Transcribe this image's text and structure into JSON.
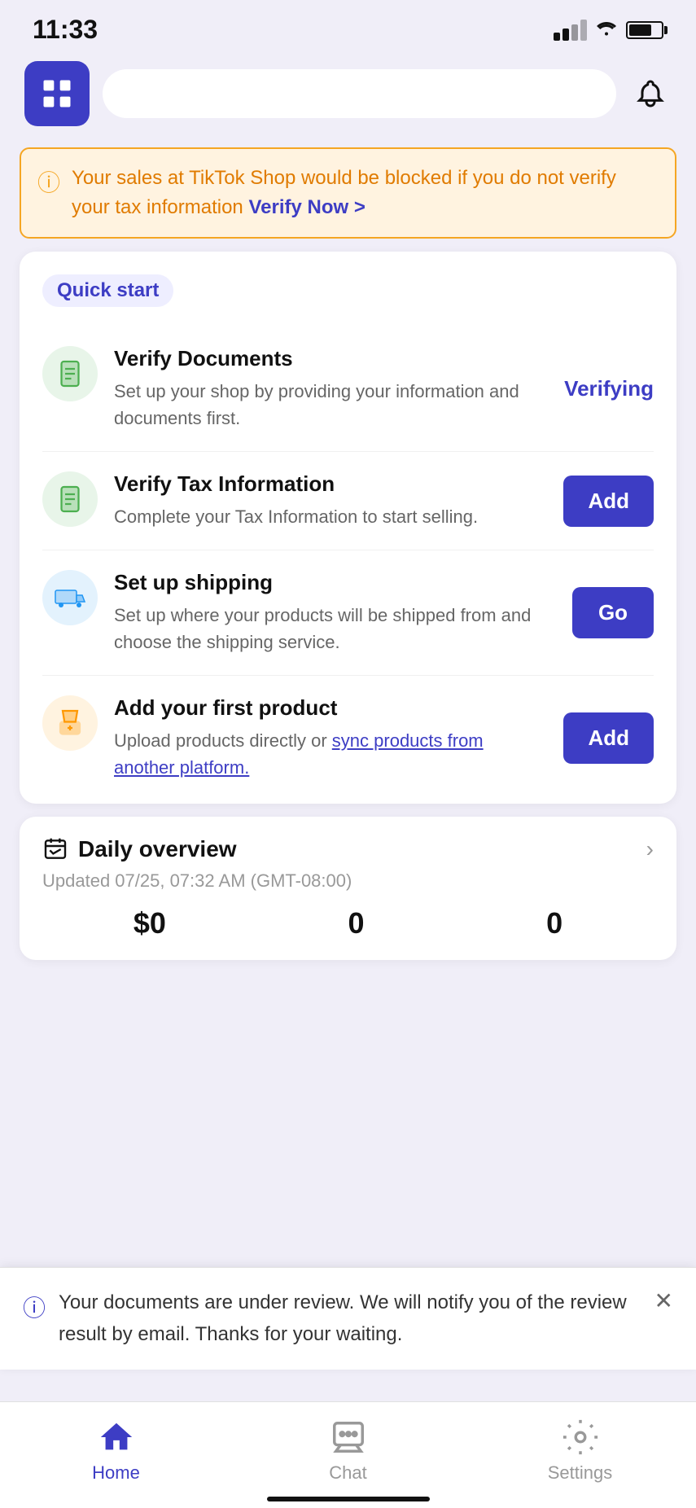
{
  "statusBar": {
    "time": "11:33"
  },
  "header": {
    "logo_alt": "TikTok Shop Logo",
    "bell_label": "Notifications"
  },
  "warning": {
    "text": "Your sales at TikTok Shop would be blocked if you do not verify your tax information ",
    "link_text": "Verify Now >",
    "icon": "⚠"
  },
  "quickStart": {
    "label": "Quick start",
    "items": [
      {
        "id": "verify-docs",
        "title": "Verify Documents",
        "description": "Set up your shop by providing your information and documents first.",
        "action_type": "text",
        "action_label": "Verifying",
        "icon": "📄",
        "icon_color": "green"
      },
      {
        "id": "verify-tax",
        "title": "Verify Tax Information",
        "description": "Complete your Tax Information to start selling.",
        "action_type": "button",
        "action_label": "Add",
        "icon": "📄",
        "icon_color": "green"
      },
      {
        "id": "setup-shipping",
        "title": "Set up shipping",
        "description": "Set up where your products will be shipped from and choose the shipping service.",
        "action_type": "button",
        "action_label": "Go",
        "icon": "🚚",
        "icon_color": "blue"
      },
      {
        "id": "add-product",
        "title": "Add your first product",
        "description": "Upload products directly or ",
        "description_link": "sync products from another platform.",
        "action_type": "button",
        "action_label": "Add",
        "icon": "🛍",
        "icon_color": "orange"
      }
    ]
  },
  "dailyOverview": {
    "title": "Daily overview",
    "updated": "Updated 07/25, 07:32 AM (GMT-08:00)",
    "stats": [
      {
        "value": "$0"
      },
      {
        "value": "0"
      },
      {
        "value": "0"
      }
    ],
    "arrow": "›"
  },
  "notification": {
    "text": "Your documents are under review. We will notify you of the review result by email. Thanks for your waiting.",
    "close_label": "✕"
  },
  "bottomNav": {
    "items": [
      {
        "id": "home",
        "label": "Home",
        "active": true
      },
      {
        "id": "chat",
        "label": "Chat",
        "active": false
      },
      {
        "id": "settings",
        "label": "Settings",
        "active": false
      }
    ]
  }
}
